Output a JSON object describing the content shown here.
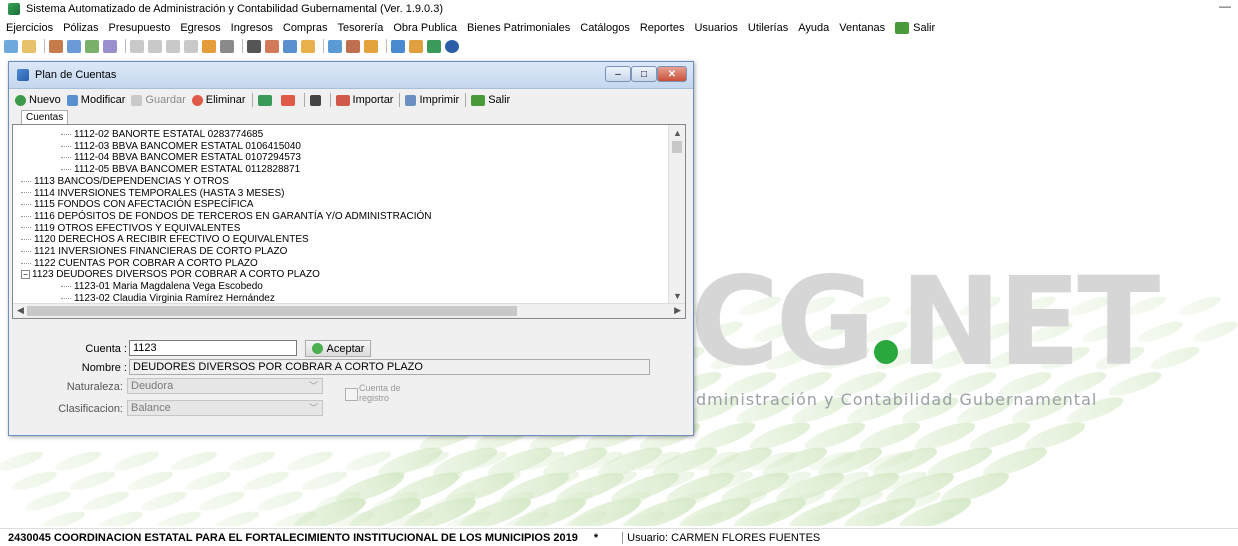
{
  "window": {
    "title": "Sistema Automatizado de Administración y Contabilidad Gubernamental  (Ver. 1.9.0.3)",
    "minimize_symbol": "—"
  },
  "menu": [
    "Ejercicios",
    "Pólizas",
    "Presupuesto",
    "Egresos",
    "Ingresos",
    "Compras",
    "Tesorería",
    "Obra Publica",
    "Bienes Patrimoniales",
    "Catálogos",
    "Reportes",
    "Usuarios",
    "Utilerías",
    "Ayuda",
    "Ventanas",
    "Salir"
  ],
  "background": {
    "logo_left": "CG",
    "logo_right": "NET",
    "subtitle": "dministración y Contabilidad Gubernamental"
  },
  "status": {
    "org": "2430045 COORDINACION ESTATAL PARA EL FORTALECIMIENTO INSTITUCIONAL DE LOS MUNICIPIOS  2019",
    "star": "*",
    "user": "Usuario: CARMEN FLORES FUENTES"
  },
  "dialog": {
    "title": "Plan de Cuentas",
    "controls": {
      "minimize": "–",
      "maximize": "□",
      "close": "✕"
    },
    "toolbar": {
      "nuevo": "Nuevo",
      "modificar": "Modificar",
      "guardar": "Guardar",
      "eliminar": "Eliminar",
      "importar": "Importar",
      "imprimir": "Imprimir",
      "salir": "Salir"
    },
    "tab": "Cuentas",
    "tree": [
      {
        "text": "1112-02  BANORTE ESTATAL 0283774685",
        "level": 2
      },
      {
        "text": "1112-03  BBVA BANCOMER ESTATAL 0106415040",
        "level": 2
      },
      {
        "text": "1112-04  BBVA BANCOMER ESTATAL 0107294573",
        "level": 2
      },
      {
        "text": "1112-05  BBVA BANCOMER ESTATAL 0112828871",
        "level": 2
      },
      {
        "text": "1113  BANCOS/DEPENDENCIAS Y OTROS",
        "level": 1
      },
      {
        "text": "1114  INVERSIONES TEMPORALES (HASTA 3 MESES)",
        "level": 1
      },
      {
        "text": "1115  FONDOS CON AFECTACIÓN ESPECÍFICA",
        "level": 1
      },
      {
        "text": "1116  DEPÓSITOS DE FONDOS DE TERCEROS EN GARANTÍA Y/O ADMINISTRACIÓN",
        "level": 1
      },
      {
        "text": "1119  OTROS EFECTIVOS Y EQUIVALENTES",
        "level": 1
      },
      {
        "text": "1120  DERECHOS A RECIBIR EFECTIVO O EQUIVALENTES",
        "level": 1
      },
      {
        "text": "1121  INVERSIONES FINANCIERAS DE CORTO PLAZO",
        "level": 1
      },
      {
        "text": "1122  CUENTAS POR COBRAR A CORTO PLAZO",
        "level": 1
      },
      {
        "text": "1123  DEUDORES DIVERSOS POR COBRAR A CORTO PLAZO",
        "level": 1,
        "expander": "−"
      },
      {
        "text": "1123-01  Maria Magdalena Vega Escobedo",
        "level": 2
      },
      {
        "text": "1123-02  Claudia Virginia Ramírez Hernández",
        "level": 2
      }
    ],
    "form": {
      "cuenta_label": "Cuenta :",
      "cuenta_value": "1123",
      "aceptar": "Aceptar",
      "nombre_label": "Nombre :",
      "nombre_value": "DEUDORES DIVERSOS POR COBRAR A CORTO PLAZO",
      "naturaleza_label": "Naturaleza:",
      "naturaleza_value": "Deudora",
      "clasificacion_label": "Clasificacion:",
      "clasificacion_value": "Balance",
      "cuenta_registro_label": "Cuenta de registro"
    }
  }
}
